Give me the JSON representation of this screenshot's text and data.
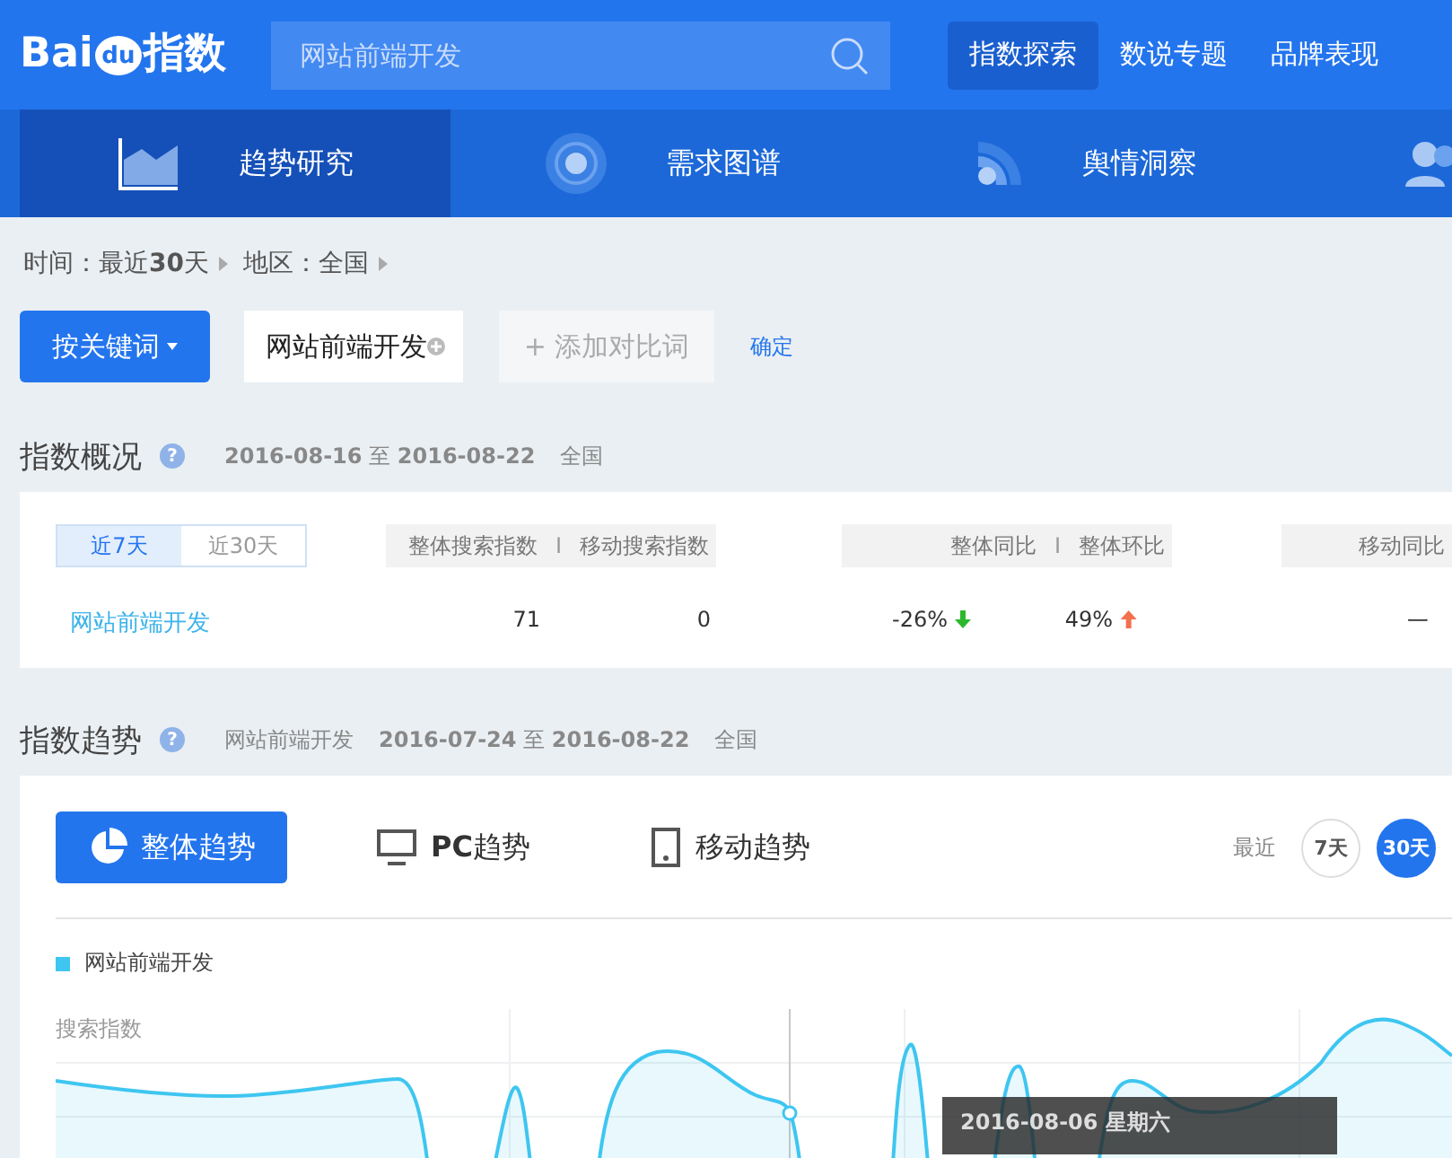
{
  "header": {
    "logo": {
      "left": "Bai",
      "badge": "du",
      "right": "指数"
    },
    "search": {
      "placeholder": "网站前端开发"
    },
    "nav": [
      {
        "label": "指数探索",
        "selected": true
      },
      {
        "label": "数说专题",
        "selected": false
      },
      {
        "label": "品牌表现",
        "selected": false
      }
    ]
  },
  "tabs": [
    {
      "label": "趋势研究",
      "kind": "trend",
      "selected": true
    },
    {
      "label": "需求图谱",
      "kind": "demand",
      "selected": false
    },
    {
      "label": "舆情洞察",
      "kind": "opinion",
      "selected": false
    },
    {
      "kind": "user",
      "selected": false
    }
  ],
  "filters": [
    "时间：最近**30**天",
    "地区：全国"
  ],
  "keyword_bar": {
    "mode_button": "按关键词",
    "keyword": "网站前端开发",
    "add": "+ 添加对比词",
    "confirm": "确定"
  },
  "overview": {
    "title": "指数概况",
    "help": "?",
    "separators": [
      "I",
      "I"
    ],
    "dates": "**2016-08-16** 至 **2016-08-22**",
    "region": "全国",
    "ranges": [
      {
        "label": "近7天",
        "selected": true
      },
      {
        "label": "近30天",
        "selected": false
      }
    ],
    "header_groups": [
      [
        "整体搜索指数",
        "移动搜索指数"
      ],
      [
        "整体同比",
        "整体环比"
      ],
      [
        "移动同比"
      ]
    ],
    "row": {
      "keyword": "网站前端开发",
      "values": [
        {
          "text": "71"
        },
        {
          "text": "0"
        },
        {
          "text": "-26%",
          "kind": "down"
        },
        {
          "text": "49%",
          "kind": "up"
        },
        {
          "text": "一"
        }
      ]
    }
  },
  "trend": {
    "title": "指数趋势",
    "help": "?",
    "keyword": "网站前端开发",
    "dates": "**2016-07-24** 至 **2016-08-22**",
    "region": "全国",
    "views": [
      {
        "label": "整体趋势",
        "kind": "all",
        "selected": true
      },
      {
        "label": "**PC**趋势",
        "kind": "pc",
        "selected": false
      },
      {
        "label": "移动趋势",
        "kind": "mobile",
        "selected": false
      }
    ],
    "recent_label": "最近",
    "periods": [
      {
        "label": "7天",
        "selected": false
      },
      {
        "label": "30天",
        "selected": true
      }
    ],
    "legend": {
      "label": "网站前端开发",
      "color": "#3ec6f0"
    },
    "ylabel": "搜索指数",
    "tooltip": "2016-08-06 星期六"
  }
}
